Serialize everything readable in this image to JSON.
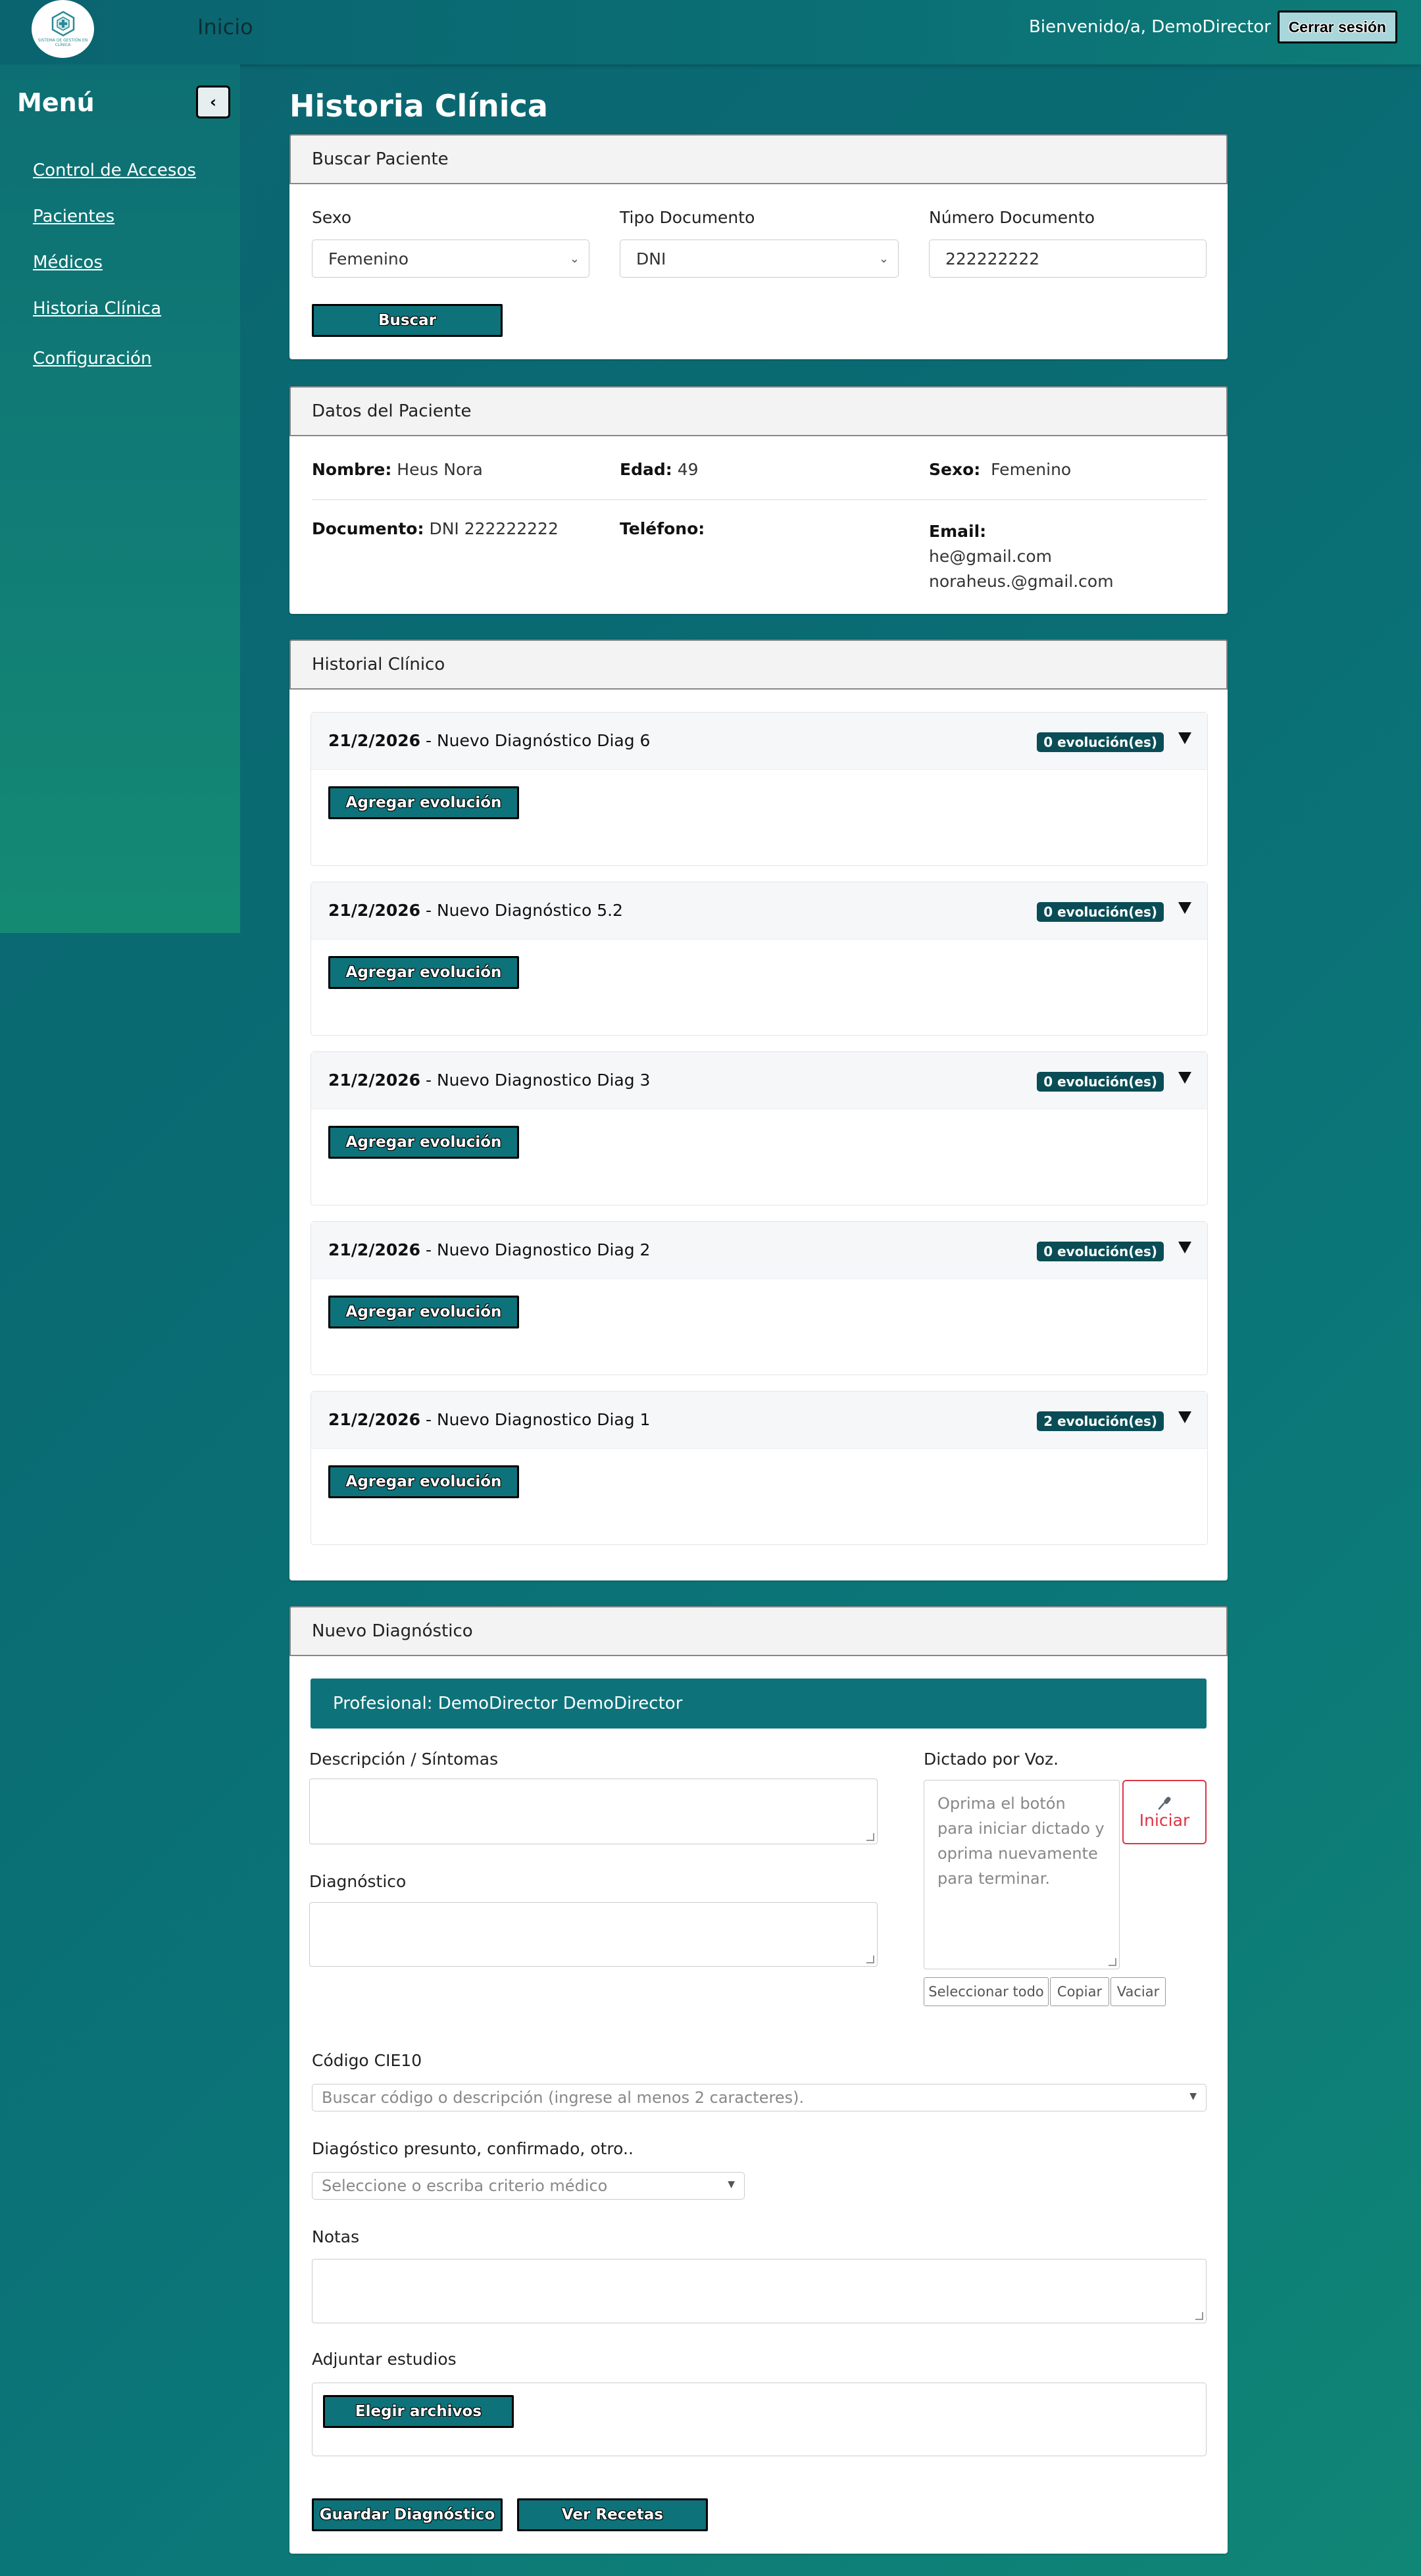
{
  "topbar": {
    "home": "Inicio",
    "welcome": "Bienvenido/a, DemoDirector",
    "logout": "Cerrar sesión",
    "logo_text": "SISTEMA DE GESTIÓN EN CLÍNICA"
  },
  "sidebar": {
    "title": "Menú",
    "toggle": "‹",
    "items": [
      "Control de Accesos",
      "Pacientes",
      "Médicos",
      "Historia Clínica",
      "Configuración"
    ]
  },
  "page_title": "Historia Clínica",
  "search": {
    "header": "Buscar Paciente",
    "sexo_label": "Sexo",
    "sexo_value": "Femenino",
    "tipo_label": "Tipo Documento",
    "tipo_value": "DNI",
    "numero_label": "Número Documento",
    "numero_value": "222222222",
    "buscar": "Buscar"
  },
  "patient": {
    "header": "Datos del Paciente",
    "nombre_label": "Nombre:",
    "nombre": "Heus Nora",
    "edad_label": "Edad:",
    "edad": "49",
    "sexo_label": "Sexo:",
    "sexo": "Femenino",
    "documento_label": "Documento:",
    "documento": "DNI  222222222",
    "telefono_label": "Teléfono:",
    "telefono": "",
    "email_label": "Email:",
    "email1": "he@gmail.com",
    "email2": "noraheus.@gmail.com"
  },
  "history": {
    "header": "Historial Clínico",
    "add_label": "Agregar evolución",
    "items": [
      {
        "date": "21/2/2026",
        "name": " - Nuevo Diagnóstico Diag 6",
        "badge": "0 evolución(es)"
      },
      {
        "date": "21/2/2026",
        "name": " - Nuevo Diagnóstico 5.2",
        "badge": "0 evolución(es)"
      },
      {
        "date": "21/2/2026",
        "name": " - Nuevo Diagnostico Diag 3",
        "badge": "0 evolución(es)"
      },
      {
        "date": "21/2/2026",
        "name": " - Nuevo Diagnostico Diag 2",
        "badge": "0 evolución(es)"
      },
      {
        "date": "21/2/2026",
        "name": " - Nuevo Diagnostico Diag 1",
        "badge": "2 evolución(es)"
      }
    ]
  },
  "new_diag": {
    "header": "Nuevo Diagnóstico",
    "profesional": "Profesional: DemoDirector DemoDirector",
    "descripcion_label": "Descripción / Síntomas",
    "diagnostico_label": "Diagnóstico",
    "dictado_label": "Dictado por Voz.",
    "dictado_placeholder": "Oprima el botón para iniciar dictado y oprima nuevamente para terminar.",
    "iniciar": "Iniciar",
    "seleccionar": "Seleccionar todo",
    "copiar": "Copiar",
    "vaciar": "Vaciar",
    "cie_label": "Código CIE10",
    "cie_placeholder": "Buscar código o descripción (ingrese al menos 2 caracteres).",
    "presunto_label": "Diagóstico presunto, confirmado, otro..",
    "presunto_placeholder": "Seleccione o escriba criterio médico",
    "notas_label": "Notas",
    "adjuntar_label": "Adjuntar estudios",
    "elegir": "Elegir archivos",
    "guardar": "Guardar Diagnóstico",
    "recetas": "Ver Recetas"
  }
}
